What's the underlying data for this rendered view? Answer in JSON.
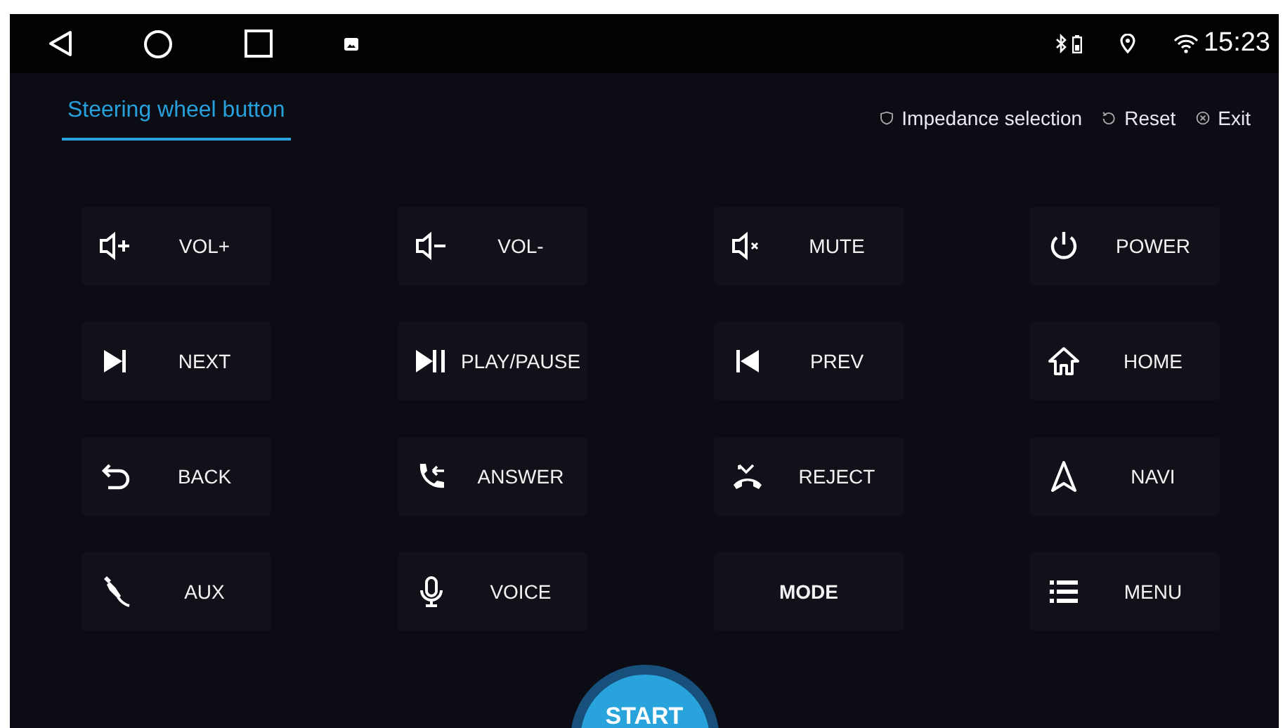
{
  "status_bar": {
    "time": "15:23"
  },
  "tabs": [
    {
      "label": "Steering wheel button",
      "selected": true
    }
  ],
  "actions": [
    {
      "kind": "shield",
      "label": "Impedance selection"
    },
    {
      "kind": "reset",
      "label": "Reset"
    },
    {
      "kind": "exit",
      "label": "Exit"
    }
  ],
  "keys": [
    {
      "kind": "vol_up",
      "label": "VOL+"
    },
    {
      "kind": "vol_down",
      "label": "VOL-"
    },
    {
      "kind": "mute",
      "label": "MUTE"
    },
    {
      "kind": "power",
      "label": "POWER"
    },
    {
      "kind": "next",
      "label": "NEXT"
    },
    {
      "kind": "play_pause",
      "label": "PLAY/PAUSE"
    },
    {
      "kind": "prev",
      "label": "PREV"
    },
    {
      "kind": "home",
      "label": "HOME"
    },
    {
      "kind": "back",
      "label": "BACK"
    },
    {
      "kind": "answer",
      "label": "ANSWER"
    },
    {
      "kind": "reject",
      "label": "REJECT"
    },
    {
      "kind": "navi",
      "label": "NAVI"
    },
    {
      "kind": "aux",
      "label": "AUX"
    },
    {
      "kind": "mic",
      "label": "VOICE"
    },
    {
      "kind": "text",
      "label": "MODE"
    },
    {
      "kind": "menu",
      "label": "MENU"
    }
  ],
  "start_button": {
    "label": "START"
  }
}
